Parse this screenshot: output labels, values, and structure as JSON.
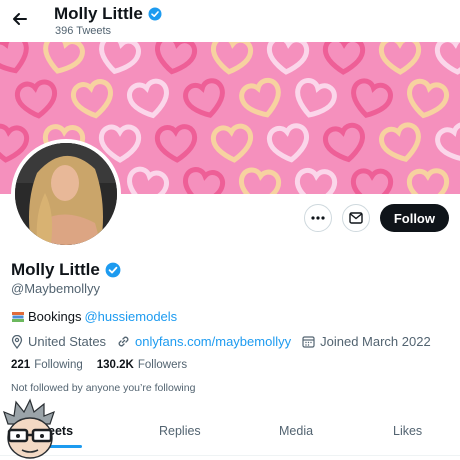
{
  "header": {
    "name": "Molly Little",
    "tweet_count": "396 Tweets"
  },
  "profile": {
    "name": "Molly Little",
    "handle": "@Maybemollyy",
    "bio_prefix": "Bookings",
    "bio_link": "@hussiemodels",
    "location": "United States",
    "website": "onlyfans.com/maybemollyy",
    "joined": "Joined March 2022",
    "following_count": "221",
    "following_label": "Following",
    "followers_count": "130.2K",
    "followers_label": "Followers",
    "followed_by": "Not followed by anyone you’re following"
  },
  "actions": {
    "follow_label": "Follow"
  },
  "tabs": [
    {
      "label": "eets"
    },
    {
      "label": "Replies"
    },
    {
      "label": "Media"
    },
    {
      "label": "Likes"
    }
  ],
  "colors": {
    "verified": "#1d9bf0",
    "link": "#1d9bf0",
    "banner": "#f590bd"
  }
}
